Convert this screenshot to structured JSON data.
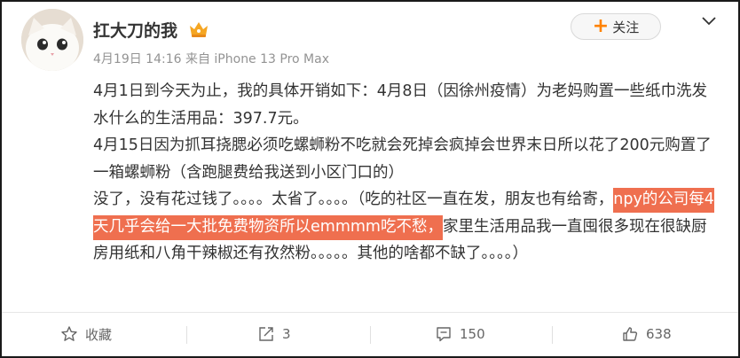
{
  "user": {
    "name": "扛大刀的我",
    "meta": "4月19日 14:16 来自 iPhone 13 Pro Max"
  },
  "header": {
    "follow_label": "关注"
  },
  "post": {
    "p1": "4月1日到今天为止，我的具体开销如下：4月8日（因徐州疫情）为老妈购置一些纸巾洗发水什么的生活用品：397.7元。",
    "p2": "4月15日因为抓耳挠腮必须吃螺蛳粉不吃就会死掉会疯掉会世界末日所以花了200元购置了一箱螺蛳粉（含跑腿费给我送到小区门口的）",
    "p3_before": "没了，没有花过钱了。。。。太省了。。。。（吃的社区一直在发，朋友也有给寄，",
    "p3_highlight": "npy的公司每4天几乎会给一大批免费物资所以emmmm吃不愁，",
    "p3_after": "家里生活用品我一直囤很多现在很缺厨房用纸和八角干辣椒还有孜然粉。。。。。其他的啥都不缺了。。。。）"
  },
  "actions": {
    "favorite_label": "收藏",
    "repost_count": "3",
    "comment_count": "150",
    "like_count": "638"
  },
  "icons": {
    "badge": "vip-crown-icon",
    "chevron": "chevron-down-icon",
    "favorite": "star-icon",
    "repost": "repost-icon",
    "comment": "comment-icon",
    "like": "thumbs-up-icon"
  },
  "colors": {
    "follow_plus": "#ff8200",
    "highlight_bg": "#ef6f4f",
    "meta_text": "#939393",
    "badge": "#f5a623"
  }
}
